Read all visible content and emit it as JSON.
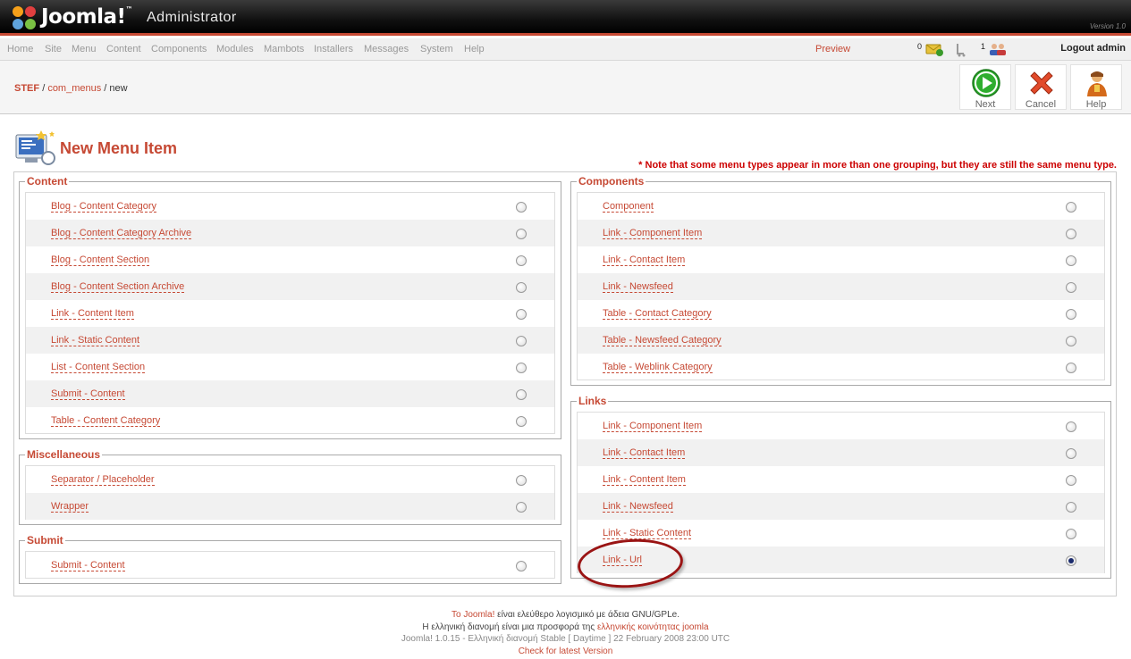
{
  "header": {
    "logo": "Joomla!",
    "logo_tm": "™",
    "admin": "Administrator",
    "version": "Version 1.0"
  },
  "menubar": {
    "items": [
      "Home",
      "Site",
      "Menu",
      "Content",
      "Components",
      "Modules",
      "Mambots",
      "Installers",
      "Messages",
      "System",
      "Help"
    ],
    "preview": "Preview",
    "messages_count": "0",
    "users_online_count": "1",
    "logout": "Logout admin"
  },
  "breadcrumb": {
    "site": "STEF",
    "sep1": "/",
    "component": "com_menus",
    "sep2": "/",
    "current": "new"
  },
  "toolbar": {
    "next": "Next",
    "cancel": "Cancel",
    "help": "Help"
  },
  "page_title": "New Menu Item",
  "note": "* Note that some menu types appear in more than one grouping, but they are still the same menu type.",
  "groups": {
    "content": {
      "legend": "Content",
      "items": [
        "Blog - Content Category",
        "Blog - Content Category Archive",
        "Blog - Content Section",
        "Blog - Content Section Archive",
        "Link - Content Item",
        "Link - Static Content",
        "List - Content Section",
        "Submit - Content",
        "Table - Content Category"
      ]
    },
    "misc": {
      "legend": "Miscellaneous",
      "items": [
        "Separator / Placeholder",
        "Wrapper"
      ]
    },
    "submit": {
      "legend": "Submit",
      "items": [
        "Submit - Content"
      ]
    },
    "components": {
      "legend": "Components",
      "items": [
        "Component",
        "Link - Component Item",
        "Link - Contact Item",
        "Link - Newsfeed",
        "Table - Contact Category",
        "Table - Newsfeed Category",
        "Table - Weblink Category"
      ]
    },
    "links": {
      "legend": "Links",
      "items": [
        "Link - Component Item",
        "Link - Contact Item",
        "Link - Content Item",
        "Link - Newsfeed",
        "Link - Static Content",
        "Link - Url"
      ],
      "selected": "Link - Url"
    }
  },
  "footer": {
    "l1_link": "To Joomla!",
    "l1_text": " είναι ελεύθερο λογισμικό με άδεια GNU/GPLe.",
    "l2_text": "Η ελληνική διανομή είναι μια προσφορά της ",
    "l2_link": "ελληνικής κοινότητας joomla",
    "l3": "Joomla! 1.0.15 - Ελληνική διανομή Stable [ Daytime ] 22 February 2008 23:00 UTC",
    "l4": "Check for latest Version"
  },
  "colors": {
    "accent": "#c64934",
    "highlight_ellipse": "#9a1414"
  }
}
